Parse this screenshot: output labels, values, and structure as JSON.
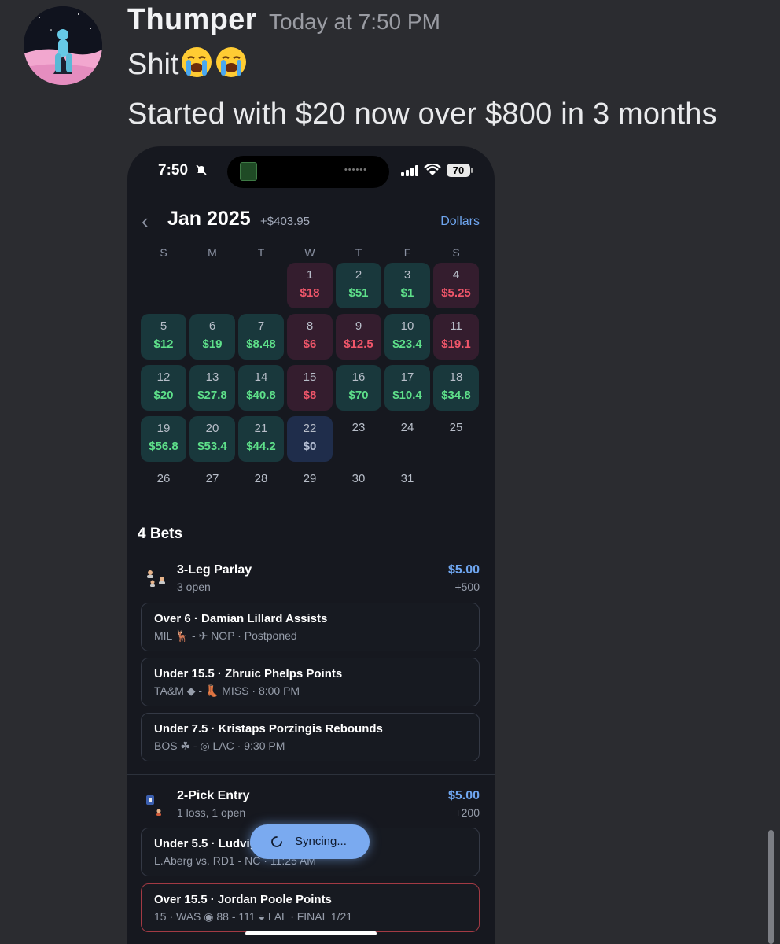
{
  "message": {
    "author": "Thumper",
    "timestamp": "Today at 7:50 PM",
    "line1": "Shit",
    "emoji": [
      "loudly-crying-face",
      "loudly-crying-face"
    ],
    "line2": "Started with $20 now over $800 in 3 months"
  },
  "phone": {
    "status": {
      "time": "7:50",
      "battery": "70"
    },
    "header": {
      "month": "Jan 2025",
      "total": "+$403.95",
      "units": "Dollars"
    },
    "weekdays": [
      "S",
      "M",
      "T",
      "W",
      "T",
      "F",
      "S"
    ],
    "days": [
      {
        "day": "1",
        "amount": "$18",
        "result": "loss"
      },
      {
        "day": "2",
        "amount": "$51",
        "result": "win"
      },
      {
        "day": "3",
        "amount": "$1",
        "result": "win"
      },
      {
        "day": "4",
        "amount": "$5.25",
        "result": "loss"
      },
      {
        "day": "5",
        "amount": "$12",
        "result": "win"
      },
      {
        "day": "6",
        "amount": "$19",
        "result": "win"
      },
      {
        "day": "7",
        "amount": "$8.48",
        "result": "win"
      },
      {
        "day": "8",
        "amount": "$6",
        "result": "loss"
      },
      {
        "day": "9",
        "amount": "$12.5",
        "result": "loss"
      },
      {
        "day": "10",
        "amount": "$23.4",
        "result": "win"
      },
      {
        "day": "11",
        "amount": "$19.1",
        "result": "loss"
      },
      {
        "day": "12",
        "amount": "$20",
        "result": "win"
      },
      {
        "day": "13",
        "amount": "$27.8",
        "result": "win"
      },
      {
        "day": "14",
        "amount": "$40.8",
        "result": "win"
      },
      {
        "day": "15",
        "amount": "$8",
        "result": "loss"
      },
      {
        "day": "16",
        "amount": "$70",
        "result": "win"
      },
      {
        "day": "17",
        "amount": "$10.4",
        "result": "win"
      },
      {
        "day": "18",
        "amount": "$34.8",
        "result": "win"
      },
      {
        "day": "19",
        "amount": "$56.8",
        "result": "win"
      },
      {
        "day": "20",
        "amount": "$53.4",
        "result": "win"
      },
      {
        "day": "21",
        "amount": "$44.2",
        "result": "win"
      },
      {
        "day": "22",
        "amount": "$0",
        "result": "zero"
      },
      {
        "day": "23",
        "amount": "",
        "result": "none"
      },
      {
        "day": "24",
        "amount": "",
        "result": "none"
      },
      {
        "day": "25",
        "amount": "",
        "result": "none"
      },
      {
        "day": "26",
        "amount": "",
        "result": "none"
      },
      {
        "day": "27",
        "amount": "",
        "result": "none"
      },
      {
        "day": "28",
        "amount": "",
        "result": "none"
      },
      {
        "day": "29",
        "amount": "",
        "result": "none"
      },
      {
        "day": "30",
        "amount": "",
        "result": "none"
      },
      {
        "day": "31",
        "amount": "",
        "result": "none"
      }
    ],
    "bets_count": "4 Bets",
    "bets": [
      {
        "title": "3-Leg Parlay",
        "status": "3 open",
        "stake": "$5.00",
        "odds": "+500",
        "legs": [
          {
            "title": "Over 6 · Damian Lillard Assists",
            "sub": "MIL 🦌 - ✈ NOP · Postponed",
            "lost": false
          },
          {
            "title": "Under 15.5 · Zhruic Phelps Points",
            "sub": "TA&M ◆ - 👢 MISS · 8:00 PM",
            "lost": false
          },
          {
            "title": "Under 7.5 · Kristaps Porzingis Rebounds",
            "sub": "BOS ☘ - ◎ LAC · 9:30 PM",
            "lost": false
          }
        ]
      },
      {
        "title": "2-Pick Entry",
        "status": "1 loss, 1 open",
        "stake": "$5.00",
        "odds": "+200",
        "legs": [
          {
            "title": "Under 5.5 · Ludvig",
            "sub": "L.Aberg vs. RD1 - NC · 11:25 AM",
            "lost": false
          },
          {
            "title": "Over 15.5 · Jordan Poole Points",
            "sub": "15 · WAS ◉ 88 - 111 ◒ LAL · FINAL 1/21",
            "lost": true
          }
        ]
      }
    ],
    "toast": "Syncing..."
  },
  "colors": {
    "win": "#5ee08a",
    "loss": "#f0566a",
    "accent": "#6fa6f0",
    "background": "#2b2c30"
  }
}
